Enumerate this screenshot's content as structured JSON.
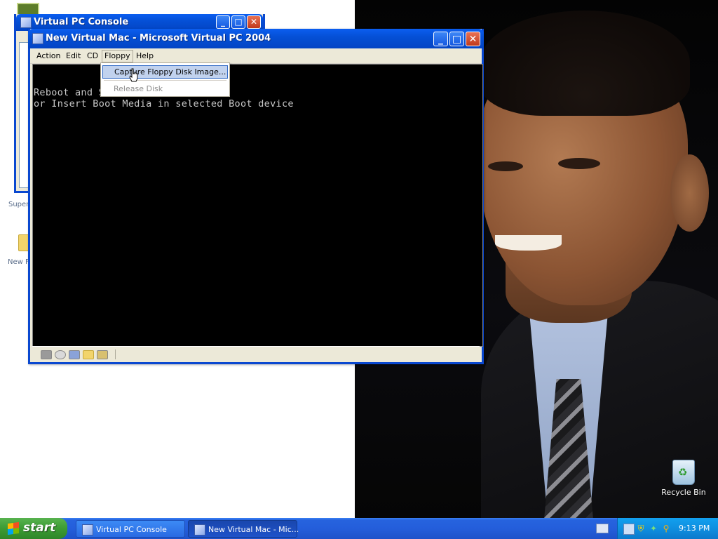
{
  "desktop": {
    "recycle_bin_label": "Recycle Bin",
    "left_label_1": "Super",
    "left_label_2": "New F"
  },
  "console_window": {
    "title": "Virtual PC Console",
    "minimize": "_",
    "maximize": "□",
    "close": "✕"
  },
  "vm_window": {
    "title": "New Virtual Mac - Microsoft Virtual PC 2004",
    "minimize": "_",
    "maximize": "□",
    "close": "✕",
    "menu": [
      "Action",
      "Edit",
      "CD",
      "Floppy",
      "Help"
    ],
    "active_menu": "Floppy",
    "console_lines": [
      "Reboot and S                  e",
      "or Insert Boot Media in selected Boot device"
    ],
    "status_icons": [
      "hard-disk-icon",
      "cd-icon",
      "floppy-icon",
      "shared-folder-icon",
      "network-icon"
    ]
  },
  "floppy_menu": {
    "items": [
      {
        "label": "Capture Floppy Disk Image...",
        "state": "highlighted"
      },
      {
        "label": "Release Disk",
        "state": "disabled"
      }
    ]
  },
  "taskbar": {
    "start_label": "start",
    "buttons": [
      {
        "label": "Virtual PC Console",
        "active": false
      },
      {
        "label": "New Virtual Mac - Mic...",
        "active": true
      }
    ],
    "tray_icons": [
      "network-icon",
      "security-shield-icon",
      "wireless-icon",
      "search-icon"
    ],
    "clock": "9:13 PM"
  },
  "colors": {
    "title_bar": "#0550d6",
    "taskbar": "#245edb",
    "start_button": "#3c9b34",
    "tray": "#0f8fe0",
    "menu_highlight": "#c1d2ee"
  }
}
